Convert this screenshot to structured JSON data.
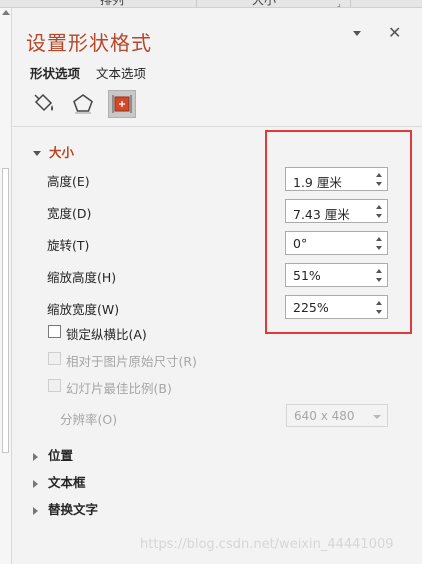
{
  "ribbon": {
    "seg1": "排列",
    "seg2": "大小"
  },
  "pane": {
    "title": "设置形状格式",
    "tabs": [
      {
        "label": "形状选项"
      },
      {
        "label": "文本选项"
      }
    ],
    "icons": [
      "fill-line-icon",
      "effects-pentagon-icon",
      "size-properties-icon"
    ]
  },
  "size_section": {
    "title": "大小",
    "fields": [
      {
        "label": "高度(E)",
        "value": "1.9 厘米"
      },
      {
        "label": "宽度(D)",
        "value": "7.43 厘米"
      },
      {
        "label": "旋转(T)",
        "value": "0°"
      },
      {
        "label": "缩放高度(H)",
        "value": "51%"
      },
      {
        "label": "缩放宽度(W)",
        "value": "225%"
      }
    ],
    "checkboxes": [
      {
        "label": "锁定纵横比(A)"
      },
      {
        "label": "相对于图片原始尺寸(R)"
      },
      {
        "label": "幻灯片最佳比例(B)"
      }
    ],
    "resolution": {
      "label": "分辨率(O)",
      "value": "640 x 480"
    }
  },
  "sections": [
    {
      "title": "位置"
    },
    {
      "title": "文本框"
    },
    {
      "title": "替换文字"
    }
  ],
  "watermark": "https://blog.csdn.net/weixin_44441009",
  "colors": {
    "accent": "#b7472a",
    "highlight_box": "#e03a3a"
  }
}
